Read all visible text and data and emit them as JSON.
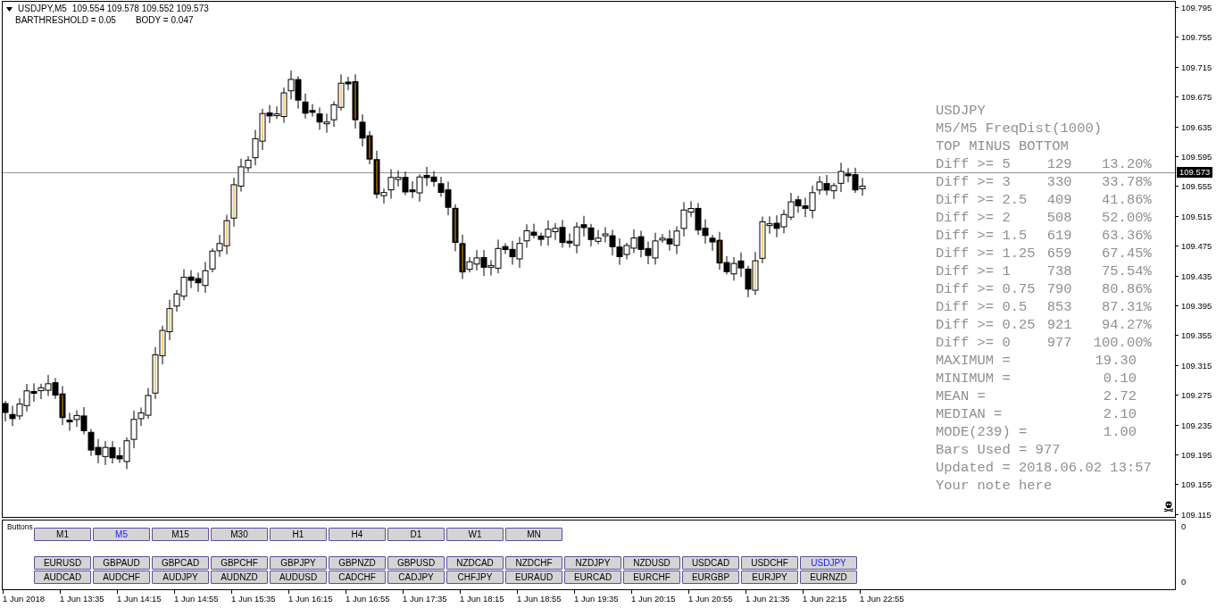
{
  "chart_header": {
    "symbol": "USDJPY,M5",
    "quotes": "109.554 109.578 109.552 109.573",
    "parameters": [
      "BARTHRESHOLD = 0.05",
      "BODY = 0.047"
    ]
  },
  "price_axis": {
    "ticks": [
      "109.795",
      "109.755",
      "109.715",
      "109.675",
      "109.635",
      "109.595",
      "109.555",
      "109.515",
      "109.475",
      "109.435",
      "109.395",
      "109.355",
      "109.315",
      "109.275",
      "109.235",
      "109.195",
      "109.155",
      "109.115"
    ],
    "current_price": "109.573"
  },
  "stats": {
    "title_lines": [
      "USDJPY",
      "M5/M5 FreqDist(1000)",
      "TOP MINUS BOTTOM"
    ],
    "diff_rows": [
      {
        "label": "Diff >= 5",
        "count": "129",
        "percent": "13.20%"
      },
      {
        "label": "Diff >= 3",
        "count": "330",
        "percent": "33.78%"
      },
      {
        "label": "Diff >= 2.5",
        "count": "409",
        "percent": "41.86%"
      },
      {
        "label": "Diff >= 2",
        "count": "508",
        "percent": "52.00%"
      },
      {
        "label": "Diff >= 1.5",
        "count": "619",
        "percent": "63.36%"
      },
      {
        "label": "Diff >= 1.25",
        "count": "659",
        "percent": "67.45%"
      },
      {
        "label": "Diff >= 1",
        "count": "738",
        "percent": "75.54%"
      },
      {
        "label": "Diff >= 0.75",
        "count": "790",
        "percent": "80.86%"
      },
      {
        "label": "Diff >= 0.5",
        "count": "853",
        "percent": "87.31%"
      },
      {
        "label": "Diff >= 0.25",
        "count": "921",
        "percent": "94.27%"
      },
      {
        "label": "Diff >= 0",
        "count": "977",
        "percent": "100.00%"
      }
    ],
    "summary_rows": [
      {
        "label": "MAXIMUM =",
        "value": "19.30"
      },
      {
        "label": "MINIMUM =",
        "value": "0.10"
      },
      {
        "label": "MEAN =",
        "value": "2.72"
      },
      {
        "label": "MEDIAN =",
        "value": "2.10"
      },
      {
        "label": "MODE(239) =",
        "value": "1.00"
      }
    ],
    "footer_lines": [
      "Bars Used = 977",
      "Updated = 2018.06.02 13:57",
      "Your note here"
    ]
  },
  "subwindow": {
    "label": "Buttons",
    "axis_labels": [
      "0",
      "0"
    ],
    "timeframe_buttons": [
      {
        "label": "M1",
        "selected": false
      },
      {
        "label": "M5",
        "selected": true
      },
      {
        "label": "M15",
        "selected": false
      },
      {
        "label": "M30",
        "selected": false
      },
      {
        "label": "H1",
        "selected": false
      },
      {
        "label": "H4",
        "selected": false
      },
      {
        "label": "D1",
        "selected": false
      },
      {
        "label": "W1",
        "selected": false
      },
      {
        "label": "MN",
        "selected": false
      }
    ],
    "symbol_rows": [
      [
        {
          "label": "EURUSD",
          "selected": false
        },
        {
          "label": "GBPAUD",
          "selected": false
        },
        {
          "label": "GBPCAD",
          "selected": false
        },
        {
          "label": "GBPCHF",
          "selected": false
        },
        {
          "label": "GBPJPY",
          "selected": false
        },
        {
          "label": "GBPNZD",
          "selected": false
        },
        {
          "label": "GBPUSD",
          "selected": false
        },
        {
          "label": "NZDCAD",
          "selected": false
        },
        {
          "label": "NZDCHF",
          "selected": false
        },
        {
          "label": "NZDJPY",
          "selected": false
        },
        {
          "label": "NZDUSD",
          "selected": false
        },
        {
          "label": "USDCAD",
          "selected": false
        },
        {
          "label": "USDCHF",
          "selected": false
        },
        {
          "label": "USDJPY",
          "selected": true
        }
      ],
      [
        {
          "label": "AUDCAD",
          "selected": false
        },
        {
          "label": "AUDCHF",
          "selected": false
        },
        {
          "label": "AUDJPY",
          "selected": false
        },
        {
          "label": "AUDNZD",
          "selected": false
        },
        {
          "label": "AUDUSD",
          "selected": false
        },
        {
          "label": "CADCHF",
          "selected": false
        },
        {
          "label": "CADJPY",
          "selected": false
        },
        {
          "label": "CHFJPY",
          "selected": false
        },
        {
          "label": "EURAUD",
          "selected": false
        },
        {
          "label": "EURCAD",
          "selected": false
        },
        {
          "label": "EURCHF",
          "selected": false
        },
        {
          "label": "EURGBP",
          "selected": false
        },
        {
          "label": "EURJPY",
          "selected": false
        },
        {
          "label": "EURNZD",
          "selected": false
        }
      ]
    ]
  },
  "time_axis": [
    "1 Jun 2018",
    "1 Jun 13:35",
    "1 Jun 14:15",
    "1 Jun 14:55",
    "1 Jun 15:35",
    "1 Jun 16:15",
    "1 Jun 16:55",
    "1 Jun 17:35",
    "1 Jun 18:15",
    "1 Jun 18:55",
    "1 Jun 19:35",
    "1 Jun 20:15",
    "1 Jun 20:55",
    "1 Jun 21:35",
    "1 Jun 22:15",
    "1 Jun 22:55"
  ]
}
